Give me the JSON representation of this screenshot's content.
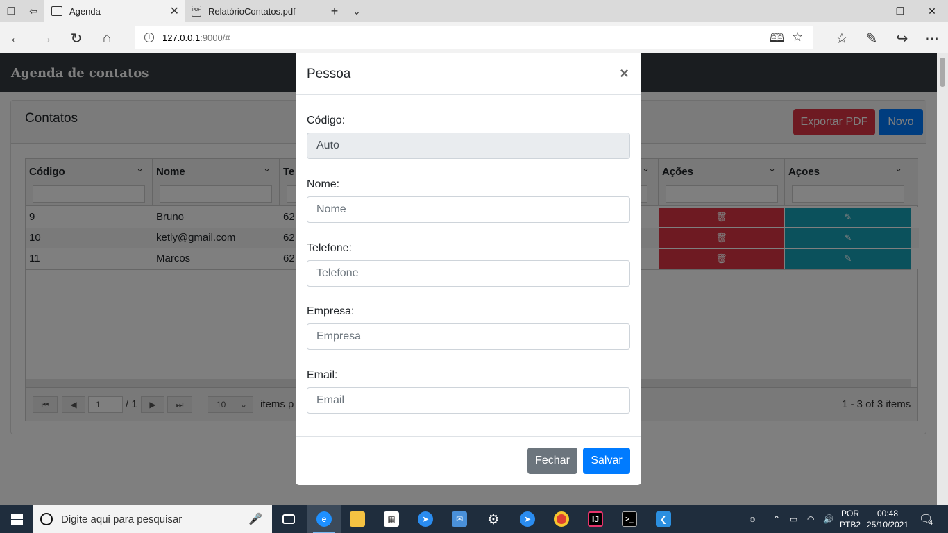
{
  "browser": {
    "tabs": [
      {
        "title": "Agenda",
        "active": true
      },
      {
        "title": "RelatórioContatos.pdf",
        "active": false
      }
    ],
    "address": {
      "host": "127.0.0.1",
      "path": ":9000/#"
    }
  },
  "app": {
    "title": "Agenda de contatos",
    "card_title": "Contatos",
    "export_label": "Exportar PDF",
    "new_label": "Novo"
  },
  "grid": {
    "columns": [
      "Código",
      "Nome",
      "Te",
      "Ações",
      "Açoes"
    ],
    "rows": [
      {
        "codigo": "9",
        "nome": "Bruno",
        "tel": "62"
      },
      {
        "codigo": "10",
        "nome": "ketly@gmail.com",
        "tel": "62"
      },
      {
        "codigo": "11",
        "nome": "Marcos",
        "tel": "62"
      }
    ],
    "pager": {
      "page": "1",
      "total_pages": "/ 1",
      "page_size": "10",
      "items_label": "items p",
      "summary": "1 - 3 of 3 items"
    }
  },
  "modal": {
    "title": "Pessoa",
    "fields": {
      "codigo": {
        "label": "Código:",
        "value": "Auto"
      },
      "nome": {
        "label": "Nome:",
        "placeholder": "Nome"
      },
      "telefone": {
        "label": "Telefone:",
        "placeholder": "Telefone"
      },
      "empresa": {
        "label": "Empresa:",
        "placeholder": "Empresa"
      },
      "email": {
        "label": "Email:",
        "placeholder": "Email"
      }
    },
    "close_label": "Fechar",
    "save_label": "Salvar"
  },
  "taskbar": {
    "search_placeholder": "Digite aqui para pesquisar",
    "lang_top": "POR",
    "lang_bottom": "PTB2",
    "time": "00:48",
    "date": "25/10/2021",
    "notifications": "4"
  },
  "colors": {
    "danger": "#dc3545",
    "primary": "#007bff",
    "info": "#17a2b8",
    "secondary": "#6c757d",
    "header": "#343a40"
  }
}
